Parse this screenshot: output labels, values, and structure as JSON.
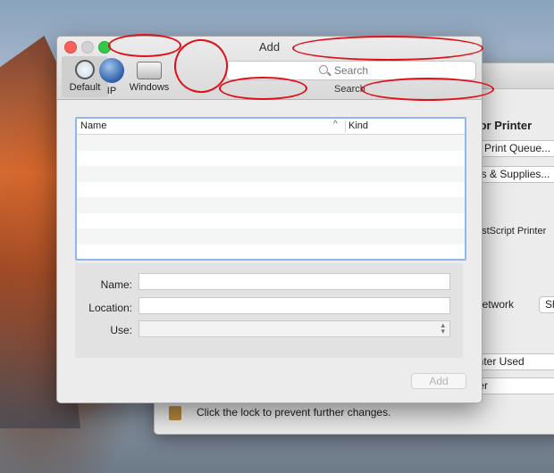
{
  "dialog": {
    "title": "Add",
    "toolbar": [
      {
        "label": "Default",
        "icon": "magnifier-printer-icon"
      },
      {
        "label": "IP",
        "icon": "globe-icon"
      },
      {
        "label": "Windows",
        "icon": "windows-printer-icon"
      }
    ],
    "search_placeholder": "Search",
    "search_label": "Search",
    "list": {
      "col_name": "Name",
      "col_kind": "Kind",
      "sort_indicator": "^"
    },
    "form": {
      "name_label": "Name:",
      "location_label": "Location:",
      "use_label": "Use:",
      "select_arrows": "⌃⌄"
    },
    "add_button": "Add"
  },
  "background_window": {
    "heading": "lor Printer",
    "open_queue": "n Print Queue...",
    "options_supplies": "ns & Supplies...",
    "type_text": "ostScript Printer",
    "network_text": "network",
    "share_btn": "Sh",
    "last_used": "inter Used",
    "paper_size": "ter",
    "lock_text": "Click the lock to prevent further changes."
  }
}
